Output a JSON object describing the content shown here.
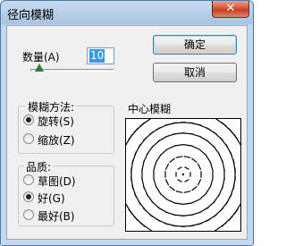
{
  "window": {
    "title": "径向模糊",
    "close_glyph": "✕"
  },
  "amount": {
    "label": "数量(A)",
    "value": "10",
    "slider_fraction": 0.1
  },
  "buttons": {
    "ok": "确定",
    "cancel": "取消"
  },
  "method": {
    "title": "模糊方法:",
    "options": [
      {
        "label": "旋转(S)",
        "checked": true
      },
      {
        "label": "缩放(Z)",
        "checked": false
      }
    ]
  },
  "quality": {
    "title": "品质:",
    "options": [
      {
        "label": "草图(D)",
        "checked": false
      },
      {
        "label": "好(G)",
        "checked": true
      },
      {
        "label": "最好(B)",
        "checked": false
      }
    ]
  },
  "blur_center": {
    "title": "中心模糊"
  },
  "colors": {
    "title_bar": "#b9cfe6",
    "close_button": "#c9482c",
    "selection": "#3399ff",
    "slider_thumb": "#2e7d32"
  }
}
